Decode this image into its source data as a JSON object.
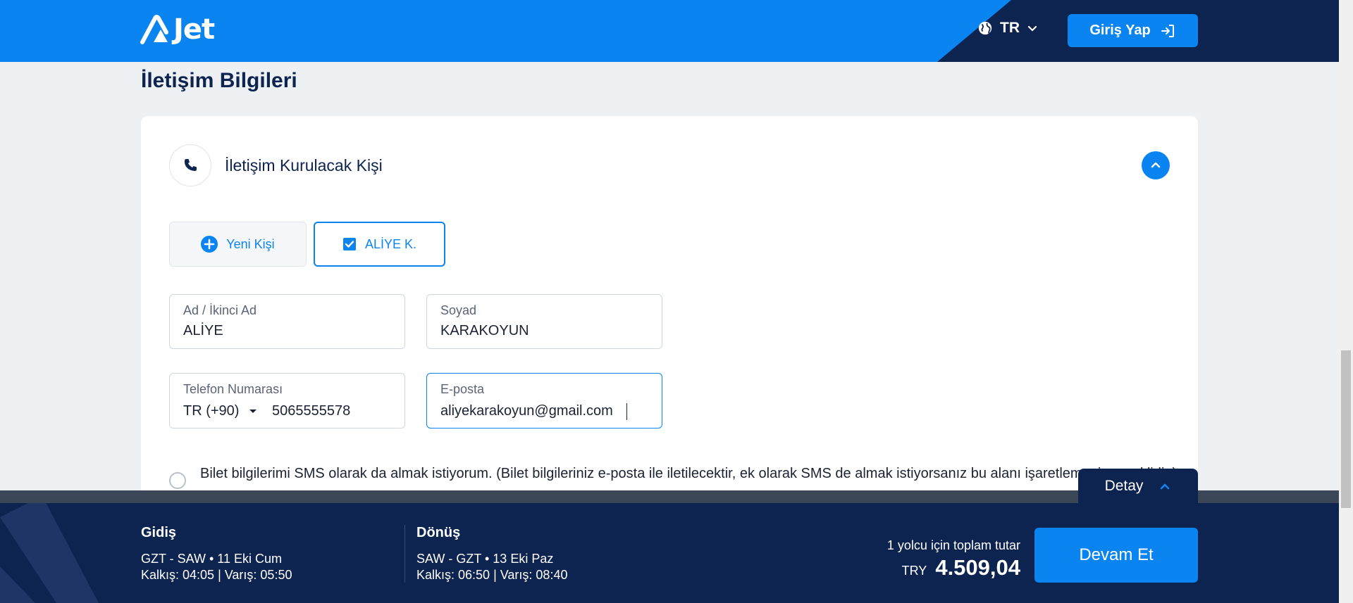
{
  "header": {
    "logo_text": "Jet",
    "language": "TR",
    "login_label": "Giriş Yap"
  },
  "section_title": "İletişim Bilgileri",
  "contact_card": {
    "heading": "İletişim Kurulacak Kişi",
    "chips": {
      "new_person": "Yeni Kişi",
      "selected_person": "ALİYE K."
    },
    "fields": {
      "first_name": {
        "label": "Ad / İkinci Ad",
        "value": "ALİYE"
      },
      "last_name": {
        "label": "Soyad",
        "value": "KARAKOYUN"
      },
      "phone": {
        "label": "Telefon Numarası",
        "country_code": "TR (+90)",
        "value": "5065555578"
      },
      "email": {
        "label": "E-posta",
        "value": "aliyekarakoyun@gmail.com"
      }
    },
    "sms_consent": "Bilet bilgilerimi SMS olarak da almak istiyorum. (Bilet bilgileriniz e-posta ile iletilecektir, ek olarak SMS de almak istiyorsanız bu alanı işaretlemeniz gereklidir.)"
  },
  "summary": {
    "detail_label": "Detay",
    "outbound": {
      "title": "Gidiş",
      "route": "GZT - SAW • 11 Eki Cum",
      "times": "Kalkış: 04:05 | Varış: 05:50"
    },
    "return": {
      "title": "Dönüş",
      "route": "SAW - GZT • 13 Eki Paz",
      "times": "Kalkış: 06:50 | Varış: 08:40"
    },
    "total_label": "1 yolcu için toplam tutar",
    "currency": "TRY",
    "total_amount": "4.509,04",
    "continue_label": "Devam Et"
  },
  "colors": {
    "brand_blue": "#0a84f0",
    "navy": "#0d2350"
  }
}
